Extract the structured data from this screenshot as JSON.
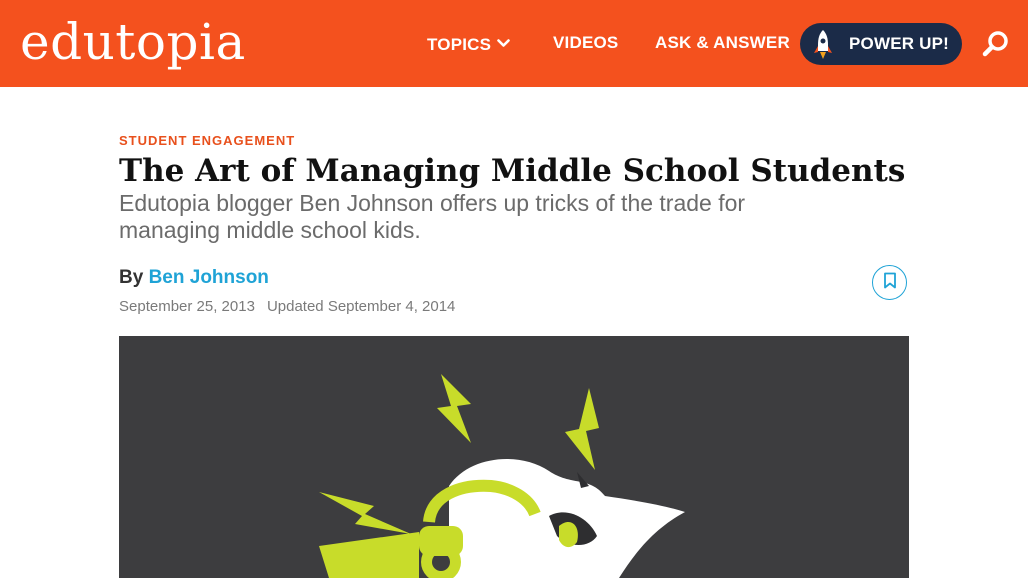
{
  "header": {
    "logo_text": "edutopia",
    "nav": {
      "topics_label": "TOPICS",
      "videos_label": "VIDEOS",
      "ask_label": "ASK & ANSWER"
    },
    "power_up_label": "POWER UP!",
    "icons": [
      "chevron-down-icon",
      "rocket-icon",
      "search-icon"
    ]
  },
  "article": {
    "kicker": "STUDENT ENGAGEMENT",
    "title": "The Art of Managing Middle School Students",
    "subtitle": "Edutopia blogger Ben Johnson offers up tricks of the trade for managing middle school kids.",
    "by_label": "By",
    "author": "Ben Johnson",
    "published": "September 25, 2013",
    "updated": "Updated September 4, 2014",
    "bookmark_icon": "bookmark-icon"
  },
  "colors": {
    "brand_orange": "#f4511e",
    "navy": "#1b2b48",
    "link_blue": "#1fa3d6",
    "hero_bg": "#3d3d3f",
    "hero_accent": "#c8dc2a"
  }
}
